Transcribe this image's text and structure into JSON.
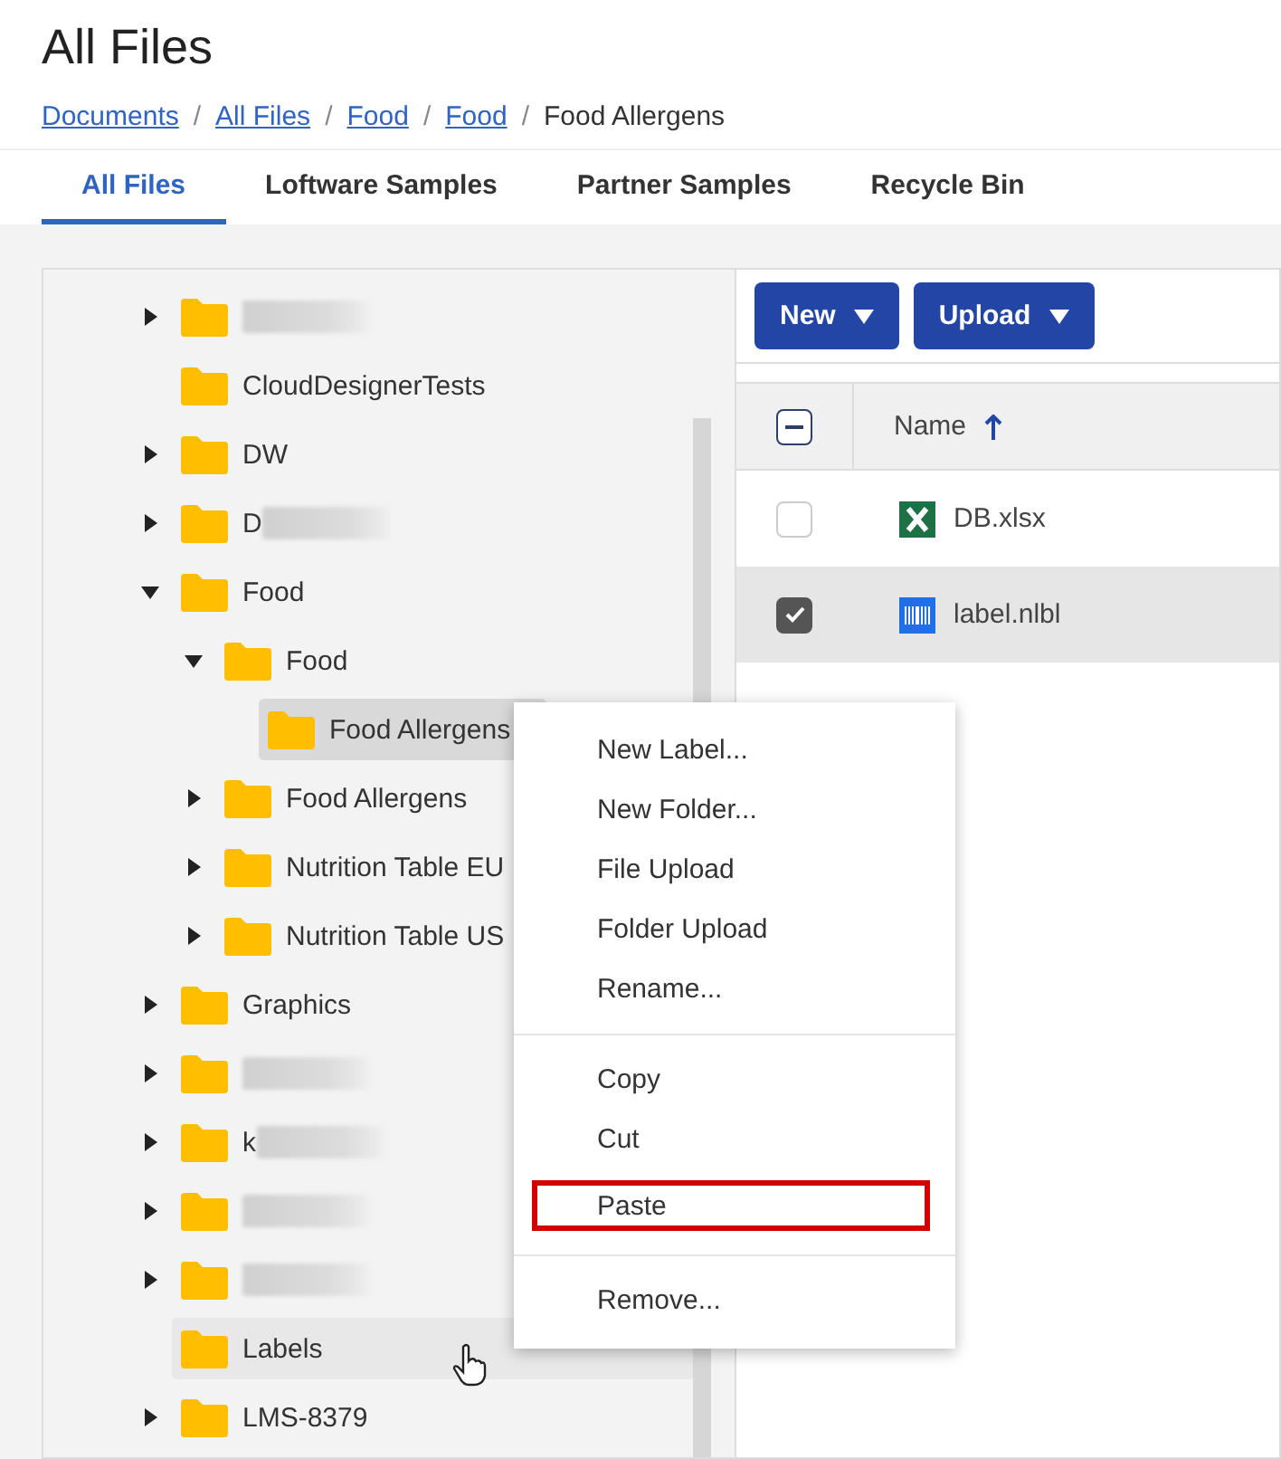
{
  "page_title": "All Files",
  "breadcrumbs": [
    {
      "label": "Documents",
      "link": true
    },
    {
      "label": "All Files",
      "link": true
    },
    {
      "label": "Food",
      "link": true
    },
    {
      "label": "Food",
      "link": true
    },
    {
      "label": "Food Allergens",
      "link": false
    }
  ],
  "breadcrumb_separator": "/",
  "tabs": [
    {
      "label": "All Files",
      "selected": true
    },
    {
      "label": "Loftware Samples",
      "selected": false
    },
    {
      "label": "Partner Samples",
      "selected": false
    },
    {
      "label": "Recycle Bin",
      "selected": false
    }
  ],
  "folder_tree": [
    {
      "expandable": true,
      "expanded": false,
      "redacted": true,
      "selected": false,
      "hovered": false
    },
    {
      "label": "CloudDesignerTests",
      "expandable": false,
      "redacted": false,
      "selected": false,
      "hovered": false
    },
    {
      "label": "DW",
      "expandable": true,
      "expanded": false,
      "redacted": false,
      "selected": false,
      "hovered": false
    },
    {
      "label": "D",
      "expandable": true,
      "expanded": false,
      "redacted": true,
      "selected": false,
      "hovered": false
    },
    {
      "label": "Food",
      "expandable": true,
      "expanded": true,
      "redacted": false,
      "selected": false,
      "hovered": false,
      "children": [
        {
          "label": "Food",
          "expandable": true,
          "expanded": true,
          "redacted": false,
          "selected": false,
          "hovered": false,
          "children": [
            {
              "label": "Food Allergens",
              "expandable": false,
              "redacted": false,
              "selected": true,
              "hovered": false
            }
          ]
        },
        {
          "label": "Food Allergens",
          "expandable": true,
          "expanded": false,
          "redacted": false,
          "selected": false,
          "hovered": false
        },
        {
          "label": "Nutrition Table EU",
          "expandable": true,
          "expanded": false,
          "redacted": false,
          "selected": false,
          "hovered": false
        },
        {
          "label": "Nutrition Table US",
          "expandable": true,
          "expanded": false,
          "redacted": false,
          "selected": false,
          "hovered": false
        }
      ]
    },
    {
      "label": "Graphics",
      "expandable": true,
      "expanded": false,
      "redacted": false,
      "selected": false,
      "hovered": false
    },
    {
      "expandable": true,
      "expanded": false,
      "redacted": true,
      "selected": false,
      "hovered": false
    },
    {
      "label": "k",
      "expandable": true,
      "expanded": false,
      "redacted": true,
      "selected": false,
      "hovered": false
    },
    {
      "expandable": true,
      "expanded": false,
      "redacted": true,
      "selected": false,
      "hovered": false
    },
    {
      "expandable": true,
      "expanded": false,
      "redacted": true,
      "selected": false,
      "hovered": false
    },
    {
      "label": "Labels",
      "expandable": false,
      "redacted": false,
      "selected": false,
      "hovered": true
    },
    {
      "label": "LMS-8379",
      "expandable": true,
      "expanded": false,
      "redacted": false,
      "selected": false,
      "hovered": false
    }
  ],
  "toolbar": [
    {
      "label": "New"
    },
    {
      "label": "Upload"
    }
  ],
  "table": {
    "select_all_partial": true,
    "name_column": "Name",
    "sorted_ascending": true,
    "rows": [
      {
        "name": "DB.xlsx",
        "kind": "spreadsheet",
        "checked": false,
        "selected": false
      },
      {
        "name": "label.nlbl",
        "kind": "label",
        "checked": true,
        "selected": true
      }
    ]
  },
  "context_menu": {
    "groups": [
      [
        {
          "label": "New Label...",
          "highlighted": false
        },
        {
          "label": "New Folder...",
          "highlighted": false
        },
        {
          "label": "File Upload",
          "highlighted": false
        },
        {
          "label": "Folder Upload",
          "highlighted": false
        },
        {
          "label": "Rename...",
          "highlighted": false
        }
      ],
      [
        {
          "label": "Copy",
          "highlighted": false
        },
        {
          "label": "Cut",
          "highlighted": false
        },
        {
          "label": "Paste",
          "highlighted": true
        }
      ],
      [
        {
          "label": "Remove...",
          "highlighted": false
        }
      ]
    ]
  }
}
